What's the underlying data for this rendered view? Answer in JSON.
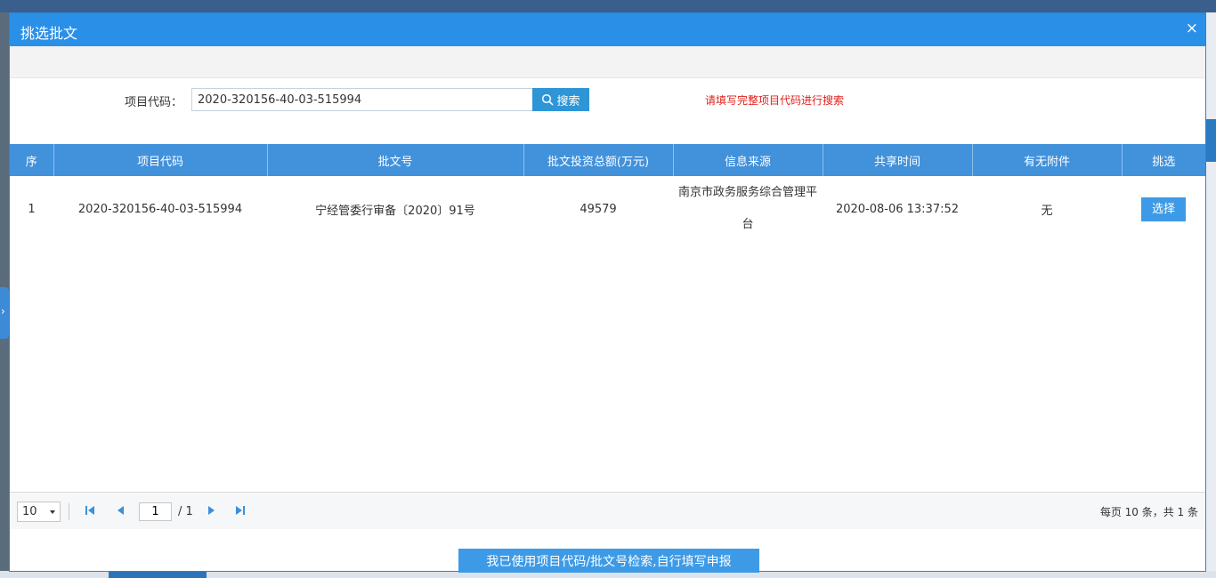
{
  "modal": {
    "title": "挑选批文",
    "close_glyph": "×"
  },
  "search": {
    "label": "项目代码：",
    "value": "2020-320156-40-03-515994",
    "button_label": "搜索",
    "hint": "请填写完整项目代码进行搜索"
  },
  "table": {
    "headers": [
      "序",
      "项目代码",
      "批文号",
      "批文投资总额(万元)",
      "信息来源",
      "共享时间",
      "有无附件",
      "挑选"
    ],
    "rows": [
      {
        "index": "1",
        "project_code": "2020-320156-40-03-515994",
        "approval_no": "宁经管委行审备〔2020〕91号",
        "amount": "49579",
        "source": "南京市政务服务综合管理平台",
        "shared_time": "2020-08-06 13:37:52",
        "attachment": "无",
        "select_label": "选择"
      }
    ]
  },
  "pager": {
    "page_size": "10",
    "current_page": "1",
    "total_pages": "/ 1",
    "info": "每页 10 条，共 1 条"
  },
  "footer": {
    "manual_button": "我已使用项目代码/批文号检索,自行填写申报"
  },
  "icons": {
    "search": "search-icon",
    "close": "close-icon",
    "first": "first-page-icon",
    "prev": "prev-page-icon",
    "next": "next-page-icon",
    "last": "last-page-icon"
  },
  "colors": {
    "header_blue": "#2a8fe7",
    "table_header": "#4191db",
    "button_blue": "#3d9ae6",
    "hint_red": "#e0201b"
  }
}
